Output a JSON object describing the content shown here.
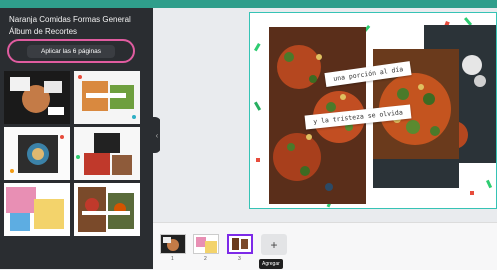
{
  "sidebar": {
    "title_line1": "Naranja Comidas Formas General",
    "title_line2": "Álbum de Recortes",
    "apply_all_label": "Aplicar las 6 páginas"
  },
  "design": {
    "caption_top": "una porción al día",
    "caption_bottom": "y la tristeza se olvida"
  },
  "pages": {
    "items": [
      {
        "number": "1"
      },
      {
        "number": "2"
      },
      {
        "number": "3"
      }
    ],
    "add_tooltip": "Agregar"
  }
}
